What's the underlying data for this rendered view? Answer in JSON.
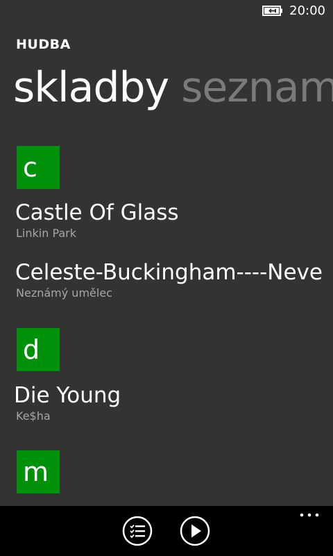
{
  "status_bar": {
    "time": "20:00",
    "battery_icon": "battery-charging-icon"
  },
  "app": {
    "title": "HUDBA"
  },
  "pivot": {
    "active": "skladby",
    "next": "seznam"
  },
  "groups": [
    {
      "letter": "c",
      "songs": [
        {
          "title": "Castle Of Glass",
          "artist": "Linkin Park"
        },
        {
          "title": "Celeste-Buckingham----Neve",
          "artist": "Neznámý umělec"
        }
      ]
    },
    {
      "letter": "d",
      "songs": [
        {
          "title": "Die Young",
          "artist": "Ke$ha"
        }
      ]
    },
    {
      "letter": "m",
      "songs": []
    }
  ],
  "app_bar": {
    "buttons": [
      {
        "icon": "playlist-icon"
      },
      {
        "icon": "play-icon"
      }
    ],
    "more_icon": "more-dots-icon"
  },
  "colors": {
    "background": "#333333",
    "accent": "#00910b",
    "secondary_text": "#a6a6a6",
    "inactive_pivot": "#7a7a7a",
    "app_bar": "#000000"
  }
}
